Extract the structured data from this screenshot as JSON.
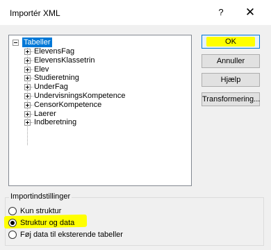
{
  "window": {
    "title": "Importér XML",
    "help_glyph": "?",
    "close_glyph": "✕"
  },
  "tree": {
    "root": "Tabeller",
    "children": [
      "ElevensFag",
      "ElevensKlassetrin",
      "Elev",
      "Studieretning",
      "UnderFag",
      "UndervisningsKompetence",
      "CensorKompetence",
      "Laerer",
      "Indberetning"
    ]
  },
  "buttons": {
    "ok": "OK",
    "cancel": "Annuller",
    "help": "Hjælp",
    "transform": "Transformering..."
  },
  "import_settings": {
    "title": "Importindstillinger",
    "options": [
      {
        "label": "Kun struktur",
        "checked": false
      },
      {
        "label": "Struktur og data",
        "checked": true
      },
      {
        "label": "Føj data til eksterende tabeller",
        "checked": false
      }
    ]
  },
  "highlight_color": "#ffff00",
  "selection_color": "#0078d7"
}
